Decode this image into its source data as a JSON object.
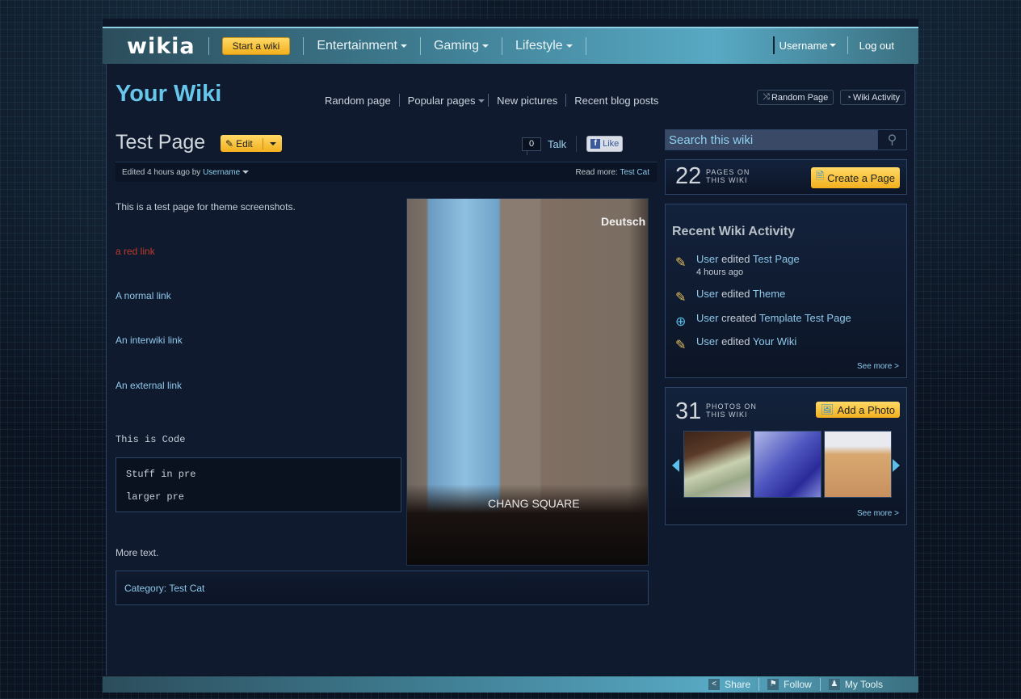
{
  "global_nav": {
    "logo": "wikia",
    "start_wiki": "Start a wiki",
    "hubs": [
      "Entertainment",
      "Gaming",
      "Lifestyle"
    ],
    "username": "Username",
    "logout": "Log out"
  },
  "wiki_header": {
    "title": "Your Wiki",
    "nav": [
      "Random page",
      "Popular pages",
      "New pictures",
      "Recent blog posts"
    ],
    "random_page_btn": "Random Page",
    "wiki_activity_btn": "Wiki Activity"
  },
  "article_header": {
    "title": "Test Page",
    "edit_label": "Edit",
    "talk_count": "0",
    "talk_label": "Talk",
    "like_label": "Like",
    "edited_prefix": "Edited 4 hours ago by",
    "edited_user": "Username",
    "read_more_prefix": "Read more:",
    "read_more_link": "Test Cat"
  },
  "article": {
    "intro": "This is a test page for theme screenshots.",
    "red_link": "a red link",
    "normal_link": "A normal link",
    "interwiki_link": "An interwiki link",
    "external_link": "An external link",
    "code": "This is Code",
    "pre_lines": [
      "Stuff in pre",
      "larger pre"
    ],
    "more_text": "More text.",
    "photo_sign_top": "Deutsch",
    "photo_sign_bottom": "CHANG SQUARE",
    "category_prefix": "Category:",
    "category_link": "Test Cat"
  },
  "rail": {
    "search_placeholder": "Search this wiki",
    "pages_count": "22",
    "pages_label_1": "PAGES ON",
    "pages_label_2": "THIS WIKI",
    "create_page": "Create a Page",
    "activity_title": "Recent Wiki Activity",
    "activity": [
      {
        "user": "User",
        "verb": "edited",
        "target": "Test Page",
        "time": "4 hours ago",
        "icon": "edit-icon"
      },
      {
        "user": "User",
        "verb": "edited",
        "target": "Theme",
        "time": "",
        "icon": "edit-icon"
      },
      {
        "user": "User",
        "verb": "created",
        "target": "Template Test Page",
        "time": "",
        "icon": "new-page-icon"
      },
      {
        "user": "User",
        "verb": "edited",
        "target": "Your Wiki",
        "time": "",
        "icon": "edit-icon"
      }
    ],
    "see_more": "See more >",
    "photos_count": "31",
    "photos_label_1": "PHOTOS ON",
    "photos_label_2": "THIS WIKI",
    "add_photo": "Add a Photo",
    "photos_see_more": "See more >"
  },
  "toolbar": {
    "share": "Share",
    "follow": "Follow",
    "my_tools": "My Tools"
  }
}
